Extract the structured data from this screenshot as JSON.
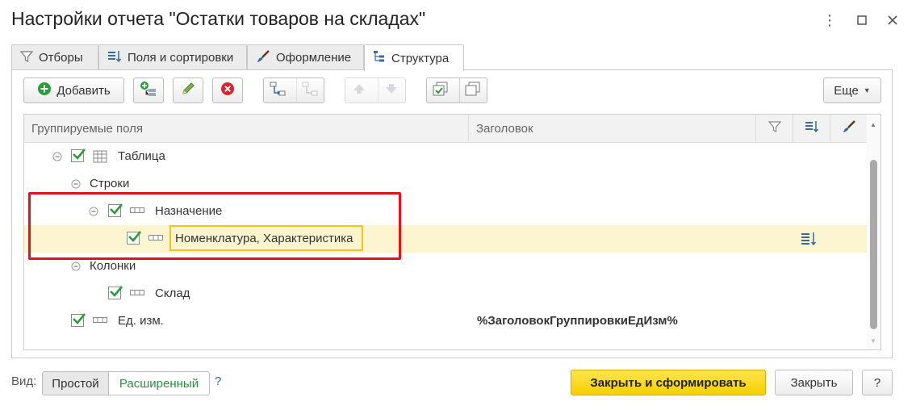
{
  "window": {
    "title": "Настройки отчета \"Остатки товаров на складах\""
  },
  "tabs": [
    {
      "label": "Отборы",
      "icon": "filter-icon"
    },
    {
      "label": "Поля и сортировки",
      "icon": "sort-icon"
    },
    {
      "label": "Оформление",
      "icon": "brush-icon"
    },
    {
      "label": "Структура",
      "icon": "structure-icon",
      "active": true
    }
  ],
  "toolbar": {
    "add_label": "Добавить",
    "more_label": "Еще"
  },
  "grid": {
    "headers": {
      "fields": "Группируемые поля",
      "title": "Заголовок"
    },
    "rows": [
      {
        "label": "Таблица"
      },
      {
        "label": "Строки"
      },
      {
        "label": "Назначение"
      },
      {
        "label": "Номенклатура, Характеристика"
      },
      {
        "label": "Колонки"
      },
      {
        "label": "Склад"
      },
      {
        "label": "Ед. изм.",
        "title": "%ЗаголовокГруппировкиЕдИзм%"
      }
    ]
  },
  "footer": {
    "view_label": "Вид:",
    "simple": "Простой",
    "advanced": "Расширенный",
    "help_q": "?",
    "close_generate": "Закрыть и сформировать",
    "close": "Закрыть",
    "help": "?"
  },
  "colors": {
    "accent_green": "#2a9d3a",
    "highlight": "#fdf5cf",
    "primary_button": "#f5d000",
    "callout": "#e5121b"
  }
}
